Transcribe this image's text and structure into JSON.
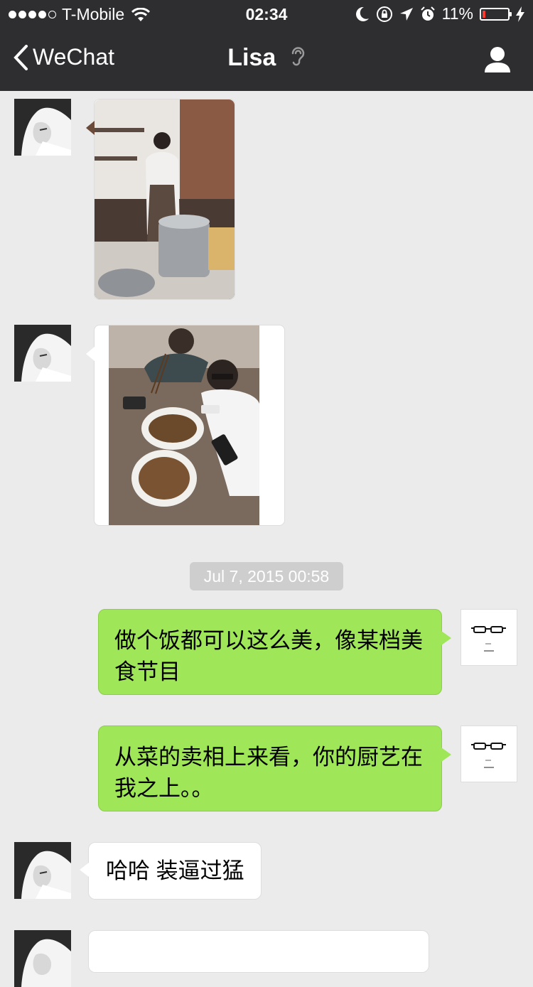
{
  "status_bar": {
    "carrier": "T-Mobile",
    "time": "02:34",
    "battery_percent": "11%",
    "battery_level": 0.11,
    "colors": {
      "battery_low": "#ff3b30"
    }
  },
  "nav": {
    "back_label": "WeChat",
    "title": "Lisa"
  },
  "theme": {
    "nav_bg": "#2e2e31",
    "chat_bg": "#ebebeb",
    "outgoing_bubble": "#9fe658",
    "incoming_bubble": "#ffffff"
  },
  "messages": {
    "timestamp": "Jul 7, 2015 00:58",
    "out1": "做个饭都可以这么美，像某档美食节目",
    "out2": "从菜的卖相上来看，你的厨艺在我之上。。",
    "in1": "哈哈 装逼过猛"
  }
}
